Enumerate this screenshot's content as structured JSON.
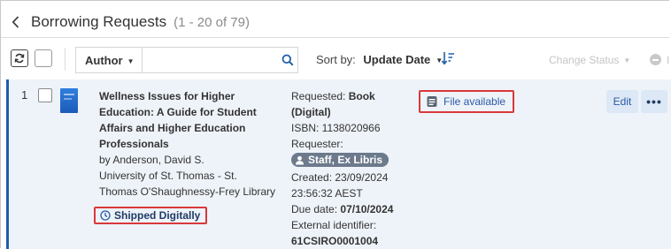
{
  "header": {
    "title": "Borrowing Requests",
    "count": "(1 - 20 of 79)"
  },
  "toolbar": {
    "filter_field": "Author",
    "search_placeholder": "",
    "sort_label": "Sort by:",
    "sort_value": "Update Date",
    "change_status_label": "Change Status"
  },
  "row": {
    "index": "1",
    "title_lines": [
      "Wellness Issues for Higher",
      "Education: A Guide for Student",
      "Affairs and Higher Education",
      "Professionals"
    ],
    "author": "by Anderson, David S.",
    "library_lines": [
      "University of St. Thomas - St.",
      "Thomas O'Shaughnessy-Frey Library"
    ],
    "shipped_status": "Shipped Digitally",
    "requested_label": "Requested:",
    "requested_value_lines": [
      "Book",
      "(Digital)"
    ],
    "isbn": "ISBN: 1138020966",
    "requester_label": "Requester:",
    "requester_name": "Staff, Ex Libris",
    "created_lines": [
      "Created: 23/09/2024",
      "23:56:32 AEST"
    ],
    "due_label": "Due date:",
    "due_value": "07/10/2024",
    "external_label": "External identifier:",
    "external_value": "61CSIRO0001004",
    "file_status": "File available",
    "edit_label": "Edit",
    "more_label": "•••"
  },
  "colors": {
    "accent": "#1f5fa8",
    "highlight_border": "#d9383b",
    "row_background": "#eef3f9",
    "pill": "#6c7a8c"
  },
  "icons": [
    "chevron-left-icon",
    "refresh-icon",
    "search-icon",
    "sort-direction-icon",
    "clock-icon",
    "person-icon",
    "file-icon",
    "minus-circle-icon"
  ]
}
